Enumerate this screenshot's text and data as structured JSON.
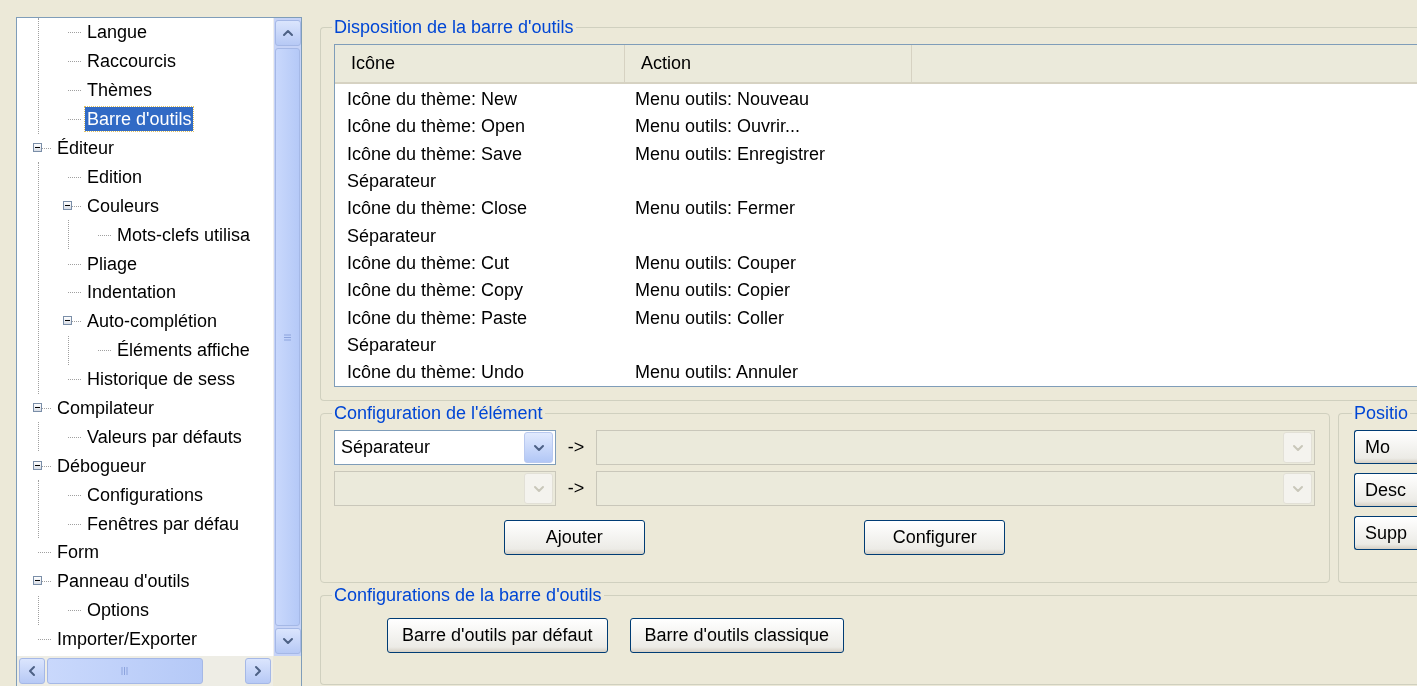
{
  "tree": {
    "cut_children": [
      {
        "label": "Langue",
        "selected": false
      },
      {
        "label": "Raccourcis",
        "selected": false
      },
      {
        "label": "Thèmes",
        "selected": false
      },
      {
        "label": "Barre d'outils",
        "selected": true
      }
    ],
    "items": [
      {
        "label": "Éditeur",
        "selected": false,
        "expanded": true,
        "children": [
          {
            "label": "Edition",
            "selected": false
          },
          {
            "label": "Couleurs",
            "selected": false,
            "expanded": true,
            "children": [
              {
                "label": "Mots-clefs utilisa",
                "selected": false
              }
            ]
          },
          {
            "label": "Pliage",
            "selected": false
          },
          {
            "label": "Indentation",
            "selected": false
          },
          {
            "label": "Auto-complétion",
            "selected": false,
            "expanded": true,
            "children": [
              {
                "label": "Éléments affiche",
                "selected": false
              }
            ]
          },
          {
            "label": "Historique de sess",
            "selected": false
          }
        ]
      },
      {
        "label": "Compilateur",
        "selected": false,
        "expanded": true,
        "children": [
          {
            "label": "Valeurs par défauts",
            "selected": false
          }
        ]
      },
      {
        "label": "Débogueur",
        "selected": false,
        "expanded": true,
        "children": [
          {
            "label": "Configurations",
            "selected": false
          },
          {
            "label": "Fenêtres par défau",
            "selected": false
          }
        ]
      },
      {
        "label": "Form",
        "selected": false
      },
      {
        "label": "Panneau d'outils",
        "selected": false,
        "expanded": true,
        "children": [
          {
            "label": "Options",
            "selected": false
          }
        ]
      },
      {
        "label": "Importer/Exporter",
        "selected": false
      }
    ]
  },
  "layout": {
    "title": "Disposition de la barre d'outils",
    "columns": [
      "Icône",
      "Action"
    ],
    "rows": [
      [
        "Icône du thème: New",
        "Menu outils: Nouveau"
      ],
      [
        "Icône du thème: Open",
        "Menu outils: Ouvrir..."
      ],
      [
        "Icône du thème: Save",
        "Menu outils: Enregistrer"
      ],
      [
        "Séparateur"
      ],
      [
        "Icône du thème: Close",
        "Menu outils: Fermer"
      ],
      [
        "Séparateur"
      ],
      [
        "Icône du thème: Cut",
        "Menu outils: Couper"
      ],
      [
        "Icône du thème: Copy",
        "Menu outils: Copier"
      ],
      [
        "Icône du thème: Paste",
        "Menu outils: Coller"
      ],
      [
        "Séparateur"
      ],
      [
        "Icône du thème: Undo",
        "Menu outils: Annuler"
      ]
    ]
  },
  "element_config": {
    "title": "Configuration de l'élément",
    "rows": [
      {
        "left": {
          "value": "Séparateur",
          "disabled": false
        },
        "arrow": "->",
        "right": {
          "disabled": true
        }
      },
      {
        "left": {
          "disabled": true
        },
        "arrow": "->",
        "right": {
          "disabled": true
        }
      }
    ],
    "buttons": [
      "Ajouter",
      "Configurer"
    ]
  },
  "position": {
    "title": "Positio",
    "buttons": [
      "Mo",
      "Desc",
      "Supp"
    ]
  },
  "toolbar_configs": {
    "title": "Configurations de la barre d'outils",
    "buttons": [
      "Barre d'outils par défaut",
      "Barre d'outils classique"
    ]
  }
}
